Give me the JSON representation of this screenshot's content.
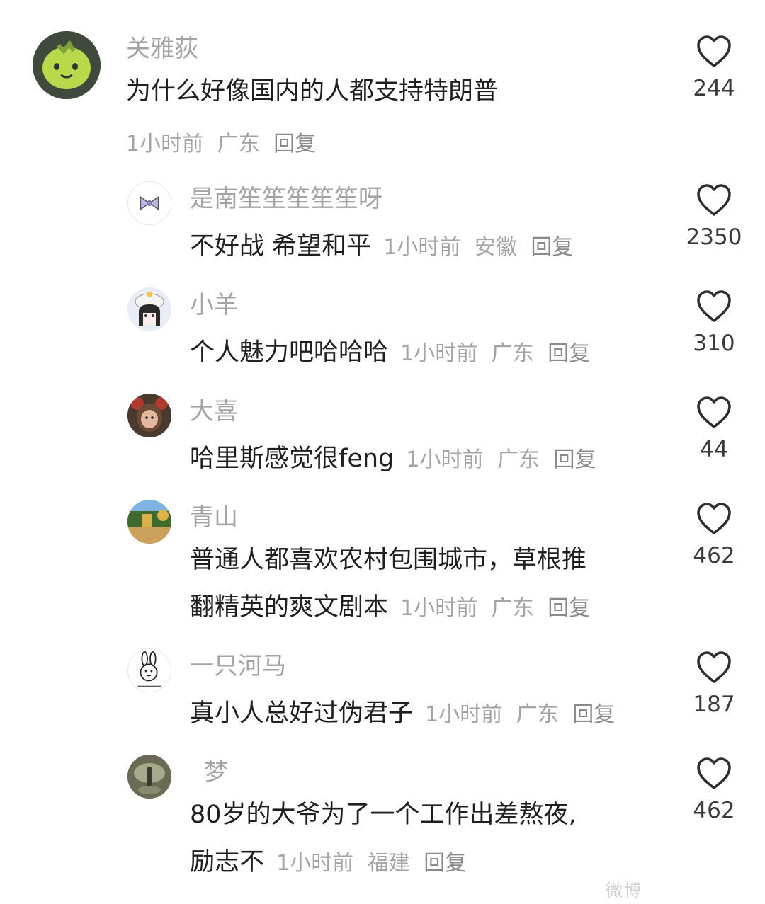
{
  "comments": [
    {
      "name": "关雅荻",
      "text": "为什么好像国内的人都支持特朗普",
      "time": "1小时前",
      "location": "广东",
      "reply": "回复",
      "likes": "244"
    },
    {
      "name": "是南笙笙笙笙笙呀",
      "text": "不好战 希望和平",
      "time": "1小时前",
      "location": "安徽",
      "reply": "回复",
      "likes": "2350"
    },
    {
      "name": "小羊",
      "text": "个人魅力吧哈哈哈",
      "time": "1小时前",
      "location": "广东",
      "reply": "回复",
      "likes": "310"
    },
    {
      "name": "大喜",
      "text": "哈里斯感觉很feng",
      "time": "1小时前",
      "location": "广东",
      "reply": "回复",
      "likes": "44"
    },
    {
      "name": "青山",
      "text_line1": "普通人都喜欢农村包围城市，草根推",
      "text_line2": "翻精英的爽文剧本",
      "time": "1小时前",
      "location": "广东",
      "reply": "回复",
      "likes": "462"
    },
    {
      "name": "一只河马",
      "text": "真小人总好过伪君子",
      "time": "1小时前",
      "location": "广东",
      "reply": "回复",
      "likes": "187"
    },
    {
      "name": "梦",
      "text_line1": "80岁的大爷为了一个工作出差熬夜,",
      "text_line2": "励志不",
      "time": "1小时前",
      "location": "福建",
      "reply": "回复",
      "likes": "462"
    }
  ],
  "watermark": "微博"
}
